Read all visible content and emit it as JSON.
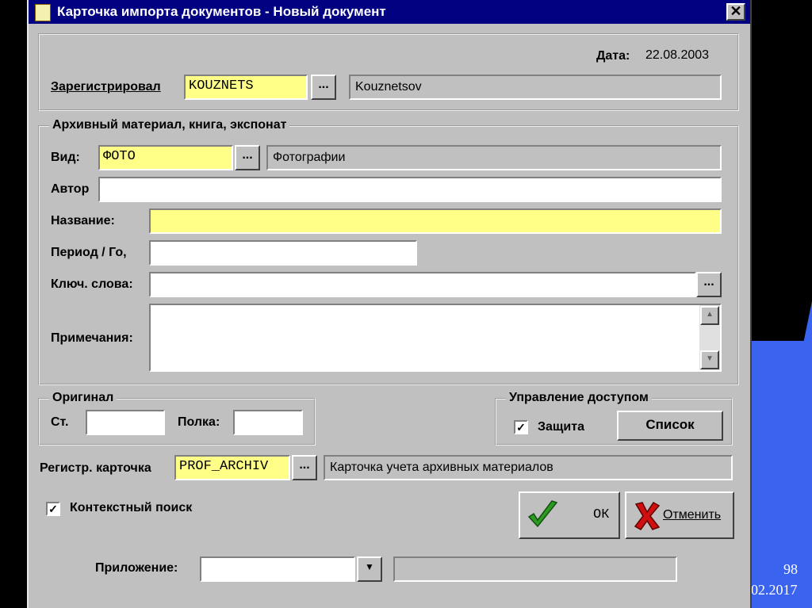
{
  "window": {
    "title": "Карточка импорта документов - Новый документ",
    "close_glyph": "✕"
  },
  "header": {
    "date_label": "Дата:",
    "date_value": "22.08.2003",
    "registered_label": "Зарегистрировал",
    "registered_code": "KOUZNETS",
    "registered_name": "Kouznetsov",
    "lookup_glyph": "..."
  },
  "archive": {
    "group_title": "Архивный материал, книга, экспонат",
    "type_label": "Вид:",
    "type_code": "ФОТО",
    "type_name": "Фотографии",
    "author_label": "Автор",
    "author_value": "",
    "title_label": "Название:",
    "title_value": "",
    "period_label": "Период / Го,",
    "period_value": "",
    "keywords_label": "Ключ. слова:",
    "keywords_value": "",
    "notes_label": "Примечания:",
    "notes_value": "",
    "scroll_up_glyph": "▲",
    "scroll_down_glyph": "▼"
  },
  "original": {
    "group_title": "Оригинал",
    "rack_label": "Ст.",
    "rack_value": "",
    "shelf_label": "Полка:",
    "shelf_value": ""
  },
  "access": {
    "group_title": "Управление доступом",
    "protect_label": "Защита",
    "protect_checked": true,
    "list_button": "Список"
  },
  "reg_card": {
    "label": "Регистр. карточка",
    "code": "PROF_ARCHIV",
    "name": "Карточка учета архивных материалов"
  },
  "context_search": {
    "label": "Контекстный поиск",
    "checked": true
  },
  "buttons": {
    "ok": "ОК",
    "cancel": "Отменить"
  },
  "app": {
    "label": "Приложение:",
    "selected": "",
    "dropdown_glyph": "▼",
    "extra": ""
  },
  "check_glyph": "✓",
  "slide": {
    "number": "98",
    "date": "02.2017"
  },
  "colors": {
    "titlebar": "#000080",
    "dialog": "#c0c0c0",
    "required_field": "#ffff88",
    "ok_check": "#2a9a20",
    "cancel_x": "#d01010",
    "slide_accent": "#3a63f0"
  }
}
